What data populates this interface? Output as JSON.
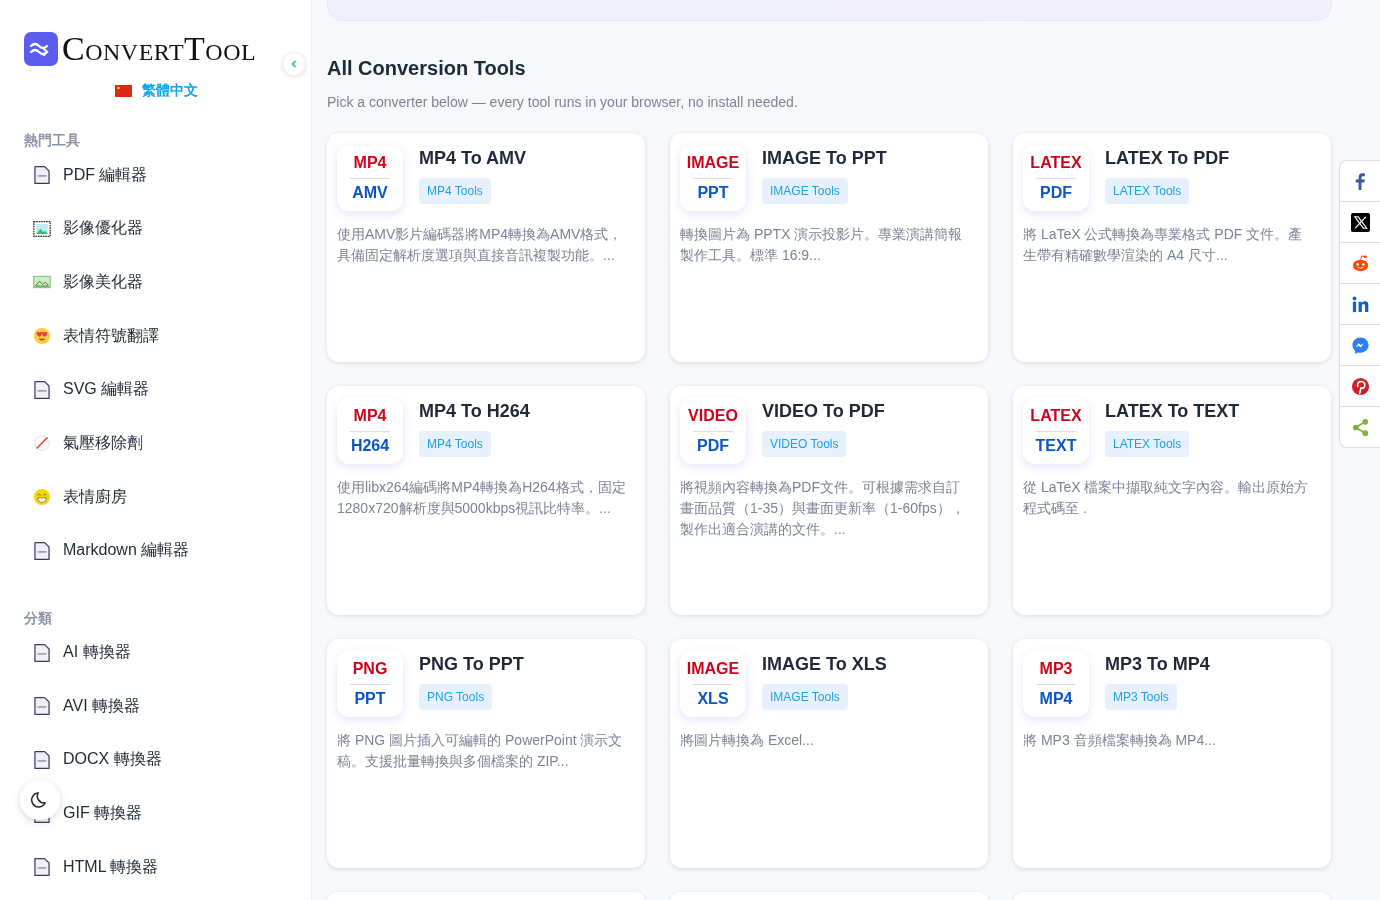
{
  "sidebar": {
    "logo": "ConvertTool",
    "language": "繁體中文",
    "sections": [
      {
        "title": "熱門工具",
        "items": [
          {
            "label": "PDF 編輯器",
            "kind": "file"
          },
          {
            "label": "影像優化器",
            "kind": "image"
          },
          {
            "label": "影像美化器",
            "kind": "photo"
          },
          {
            "label": "表情符號翻譯",
            "kind": "heart-eyes"
          },
          {
            "label": "SVG 編輯器",
            "kind": "file"
          },
          {
            "label": "氣壓移除劑",
            "kind": "slash"
          },
          {
            "label": "表情廚房",
            "kind": "grin"
          },
          {
            "label": "Markdown 編輯器",
            "kind": "file"
          }
        ]
      },
      {
        "title": "分類",
        "items": [
          {
            "label": "AI 轉換器",
            "kind": "file"
          },
          {
            "label": "AVI 轉換器",
            "kind": "file"
          },
          {
            "label": "DOCX 轉換器",
            "kind": "file"
          },
          {
            "label": "GIF 轉換器",
            "kind": "file"
          },
          {
            "label": "HTML 轉換器",
            "kind": "file"
          }
        ]
      }
    ]
  },
  "main": {
    "title": "All Conversion Tools",
    "subtitle": "Pick a converter below — every tool runs in your browser, no install needed.",
    "cards": [
      {
        "kind": "tool",
        "from": "MP4",
        "to": "AMV",
        "title": "MP4 To AMV",
        "tag": "MP4 Tools",
        "description": "使用AMV影片編碼器將MP4轉換為AMV格式，具備固定解析度選項與直接音訊複製功能。..."
      },
      {
        "kind": "tool",
        "from": "IMAGE",
        "to": "PPT",
        "title": "IMAGE To PPT",
        "tag": "IMAGE Tools",
        "description": "轉換圖片為 PPTX 演示投影片。專業演講簡報製作工具。標準 16:9..."
      },
      {
        "kind": "tool",
        "from": "LATEX",
        "to": "PDF",
        "title": "LATEX To PDF",
        "tag": "LATEX Tools",
        "description": "將 LaTeX 公式轉換為專業格式 PDF 文件。產生帶有精確數學渲染的 A4 尺寸..."
      },
      {
        "kind": "tool",
        "from": "MP4",
        "to": "H264",
        "title": "MP4 To H264",
        "tag": "MP4 Tools",
        "description": "使用libx264編碼將MP4轉換為H264格式，固定1280x720解析度與5000kbps視訊比特率。..."
      },
      {
        "kind": "tool",
        "from": "VIDEO",
        "to": "PDF",
        "title": "VIDEO To PDF",
        "tag": "VIDEO Tools",
        "description": "將視頻內容轉換為PDF文件。可根據需求自訂畫面品質（1-35）與畫面更新率（1-60fps），製作出適合演講的文件。..."
      },
      {
        "kind": "tool",
        "from": "LATEX",
        "to": "TEXT",
        "title": "LATEX To TEXT",
        "tag": "LATEX Tools",
        "description": "從 LaTeX 檔案中擷取純文字內容。輸出原始方程式碼至 ."
      },
      {
        "kind": "tool",
        "from": "PNG",
        "to": "PPT",
        "title": "PNG To PPT",
        "tag": "PNG Tools",
        "description": "將 PNG 圖片插入可編輯的 PowerPoint 演示文稿。支援批量轉換與多個檔案的 ZIP..."
      },
      {
        "kind": "tool",
        "from": "IMAGE",
        "to": "XLS",
        "title": "IMAGE To XLS",
        "tag": "IMAGE Tools",
        "description": "將圖片轉換為 Excel..."
      },
      {
        "kind": "tool",
        "from": "MP3",
        "to": "MP4",
        "title": "MP3 To MP4",
        "tag": "MP3 Tools",
        "description": "將 MP3 音頻檔案轉換為 MP4..."
      },
      {
        "kind": "partial"
      },
      {
        "kind": "partial"
      },
      {
        "kind": "partial"
      }
    ]
  },
  "share": [
    {
      "kind": "facebook"
    },
    {
      "kind": "x"
    },
    {
      "kind": "reddit"
    },
    {
      "kind": "linkedin"
    },
    {
      "kind": "messenger"
    },
    {
      "kind": "pinterest"
    },
    {
      "kind": "share"
    }
  ]
}
